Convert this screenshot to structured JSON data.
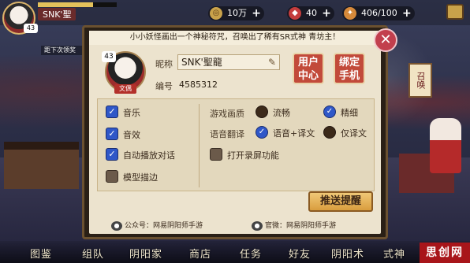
{
  "top_bar": {
    "player_level": "43",
    "player_name": "SNK'聖",
    "player_bar_progress": 0.7,
    "resources": [
      {
        "icon": "coin-icon",
        "value": "10万"
      },
      {
        "icon": "jade-icon",
        "value": "40"
      },
      {
        "icon": "stamina-icon",
        "value": "406/100"
      }
    ]
  },
  "left_stack": [
    "距下次领奖"
  ],
  "right_summon_label": "召唤",
  "bottom_nav": [
    "图鉴",
    "组队",
    "阴阳家",
    "商店",
    "任务",
    "好友",
    "阴阳术",
    "式神"
  ],
  "watermark": "思创网",
  "dialog": {
    "hint": "小小妖怪画出一个神秘符咒，召唤出了稀有SR式神 青坊主！",
    "avatar_level": "43",
    "avatar_tag": "文偶",
    "nickname_label": "昵称",
    "nickname_value": "SNK'聖龍",
    "id_label": "编号",
    "id_value": "4585312",
    "user_center": "用户中心",
    "bind_phone": "绑定手机",
    "left_options": [
      {
        "label": "音乐",
        "checked": true
      },
      {
        "label": "音效",
        "checked": true
      },
      {
        "label": "自动播放对话",
        "checked": true
      },
      {
        "label": "模型描边",
        "checked": false
      }
    ],
    "quality_label": "游戏画质",
    "quality_options": [
      {
        "label": "流畅",
        "checked": false
      },
      {
        "label": "精细",
        "checked": true
      }
    ],
    "voice_label": "语音翻译",
    "voice_options": [
      {
        "label": "语音+译文",
        "checked": true
      },
      {
        "label": "仅译文",
        "checked": false
      }
    ],
    "record_option": {
      "label": "打开录屏功能",
      "checked": false
    },
    "push_button": "推送提醒",
    "wechat_text": "公众号：网易阴阳师手游",
    "weibo_text": "官微：网易阴阳师手游"
  }
}
